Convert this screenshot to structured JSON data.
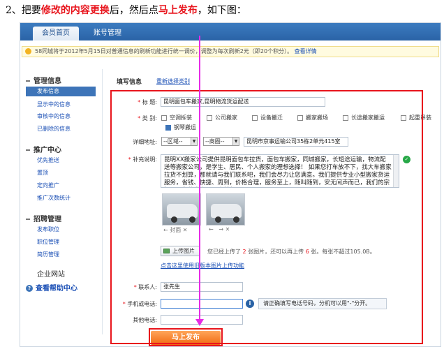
{
  "instruction": {
    "prefix": "2、把要",
    "highlight1": "修改的内容更换",
    "middle": "后，然后点",
    "highlight2": "马上发布",
    "suffix": "，如下图："
  },
  "topnav": {
    "tabs": [
      {
        "label": "会员首页",
        "active": true
      },
      {
        "label": "账号管理",
        "active": false
      }
    ]
  },
  "notice": {
    "text": "58同城将于2012年5月15日对普通信息的刷新功能进行统一调价，调整为每次刷新2元（即20个积分）。",
    "link": "查看详情"
  },
  "sidebar": {
    "groups": [
      {
        "title": "管理信息",
        "items": [
          "发布信息",
          "显示中的信息",
          "审核中的信息",
          "已删除的信息"
        ]
      },
      {
        "title": "推广中心",
        "items": [
          "优先推送",
          "置顶",
          "定向推广",
          "推广次数统计"
        ]
      },
      {
        "title": "招聘管理",
        "items": [
          "发布职位",
          "职位管理",
          "简历管理"
        ]
      }
    ],
    "enterprise": "企业网站",
    "help": "查看帮助中心"
  },
  "form": {
    "heading": "填写信息",
    "reselect": "重新选择类别",
    "title_label": "标 题:",
    "title_value": "昆明面包车搬家,昆明物流货运配送",
    "category_label": "类 别:",
    "categories": [
      {
        "label": "空调拆装",
        "checked": false
      },
      {
        "label": "公司搬家",
        "checked": false
      },
      {
        "label": "设备搬迁",
        "checked": false
      },
      {
        "label": "搬家搬场",
        "checked": false
      },
      {
        "label": "长途搬家搬运",
        "checked": false
      },
      {
        "label": "起重吊装",
        "checked": false
      },
      {
        "label": "钢琴搬运",
        "checked": true
      }
    ],
    "address_label": "详细地址:",
    "district": "--区域--",
    "area": "--商圈--",
    "address_value": "昆明市京事运输公司35栋2单元415室",
    "desc_label": "补充说明:",
    "desc_value": "昆明XX搬家公司提供昆明面包车拉货，面包车搬家，同城搬家，长短途运输，物流配送等搬家公司，是学生、居民、个人搬家的理想选择！ 如果您打车放不下，找大车搬家拉货不划算，那就请与我们联系吧，我们会尽力让您满意。我们提供专业小型搬家货运服务，省钱、快捷、周到，价格合理，服务至上，随叫随到，安无间声而已，我们的宗旨是：你的满意，是我们永",
    "photo_cover": "封面",
    "upload_button": "上传图片",
    "upload_info_a": "您已经上传了",
    "upload_count": "2",
    "upload_info_b": "张图片，还可以再上传",
    "upload_remaining": "6",
    "upload_info_c": "张。每张不超过10",
    "upload_info_d": "5.0B。",
    "old_upload": "点击这里使用旧版本图片上传功能",
    "contact_label": "联系人:",
    "contact_value": "张先生",
    "phone_label": "手机或电话:",
    "phone_value": "",
    "phone_tip": "请正确填写电话号码，分机可以用\"-\"分开。",
    "other_phone_label": "其他电话:",
    "other_phone_value": "",
    "submit": "马上发布"
  },
  "colors": {
    "annotation_red": "#e8141c",
    "arrow_magenta": "#e62be6",
    "nav_blue": "#2a63a6",
    "submit_orange": "#f06a10"
  }
}
